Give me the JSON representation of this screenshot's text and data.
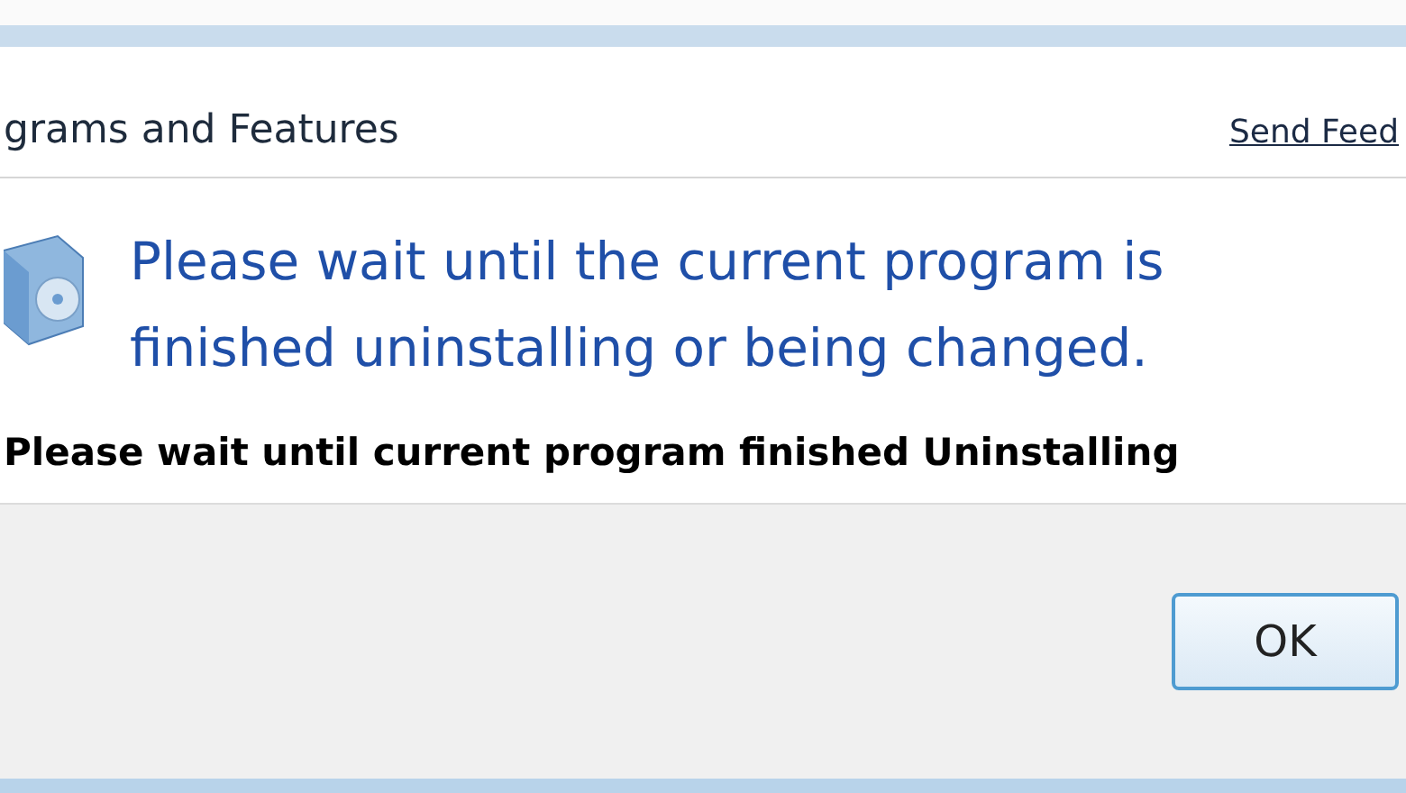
{
  "window": {
    "title": "grams and Features",
    "link": "Send Feed"
  },
  "message": {
    "lines": [
      "Please wait until the current program is",
      "finished uninstalling or being changed."
    ]
  },
  "caption": "Please wait until current program finished Uninstalling",
  "buttons": [
    "OK"
  ]
}
